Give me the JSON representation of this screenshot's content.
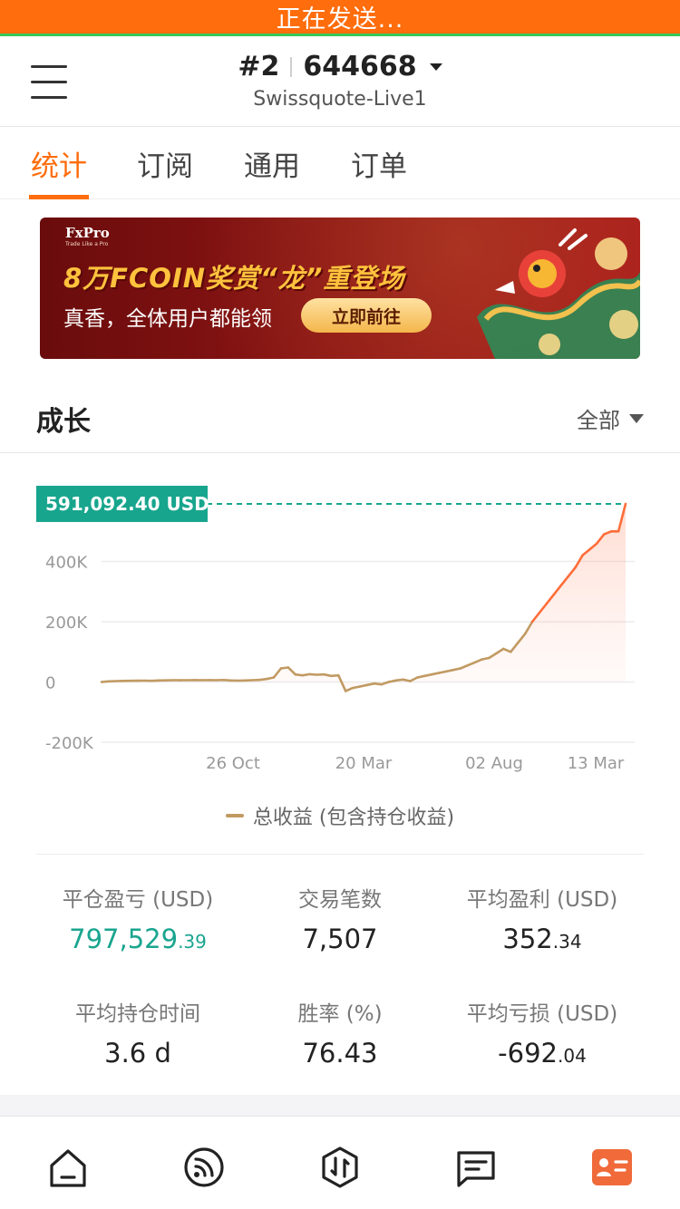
{
  "status": {
    "text": "正在发送..."
  },
  "header": {
    "account_index": "#2",
    "account_number": "644668",
    "server": "Swissquote-Live1"
  },
  "tabs": [
    {
      "label": "统计",
      "active": true
    },
    {
      "label": "订阅",
      "active": false
    },
    {
      "label": "通用",
      "active": false
    },
    {
      "label": "订单",
      "active": false
    }
  ],
  "banner": {
    "brand": "FxPro",
    "tagline": "Trade Like a Pro",
    "headline": "8万FCOIN奖赏“龙”重登场",
    "subtitle": "真香，全体用户都能领",
    "cta": "立即前往"
  },
  "growth": {
    "title": "成长",
    "filter": "全部"
  },
  "chart_data": {
    "type": "area",
    "current_value_label": "591,092.40 USD",
    "current_value": 591092.4,
    "y_ticks": [
      "400K",
      "200K",
      "0",
      "-200K"
    ],
    "x_ticks": [
      "26 Oct",
      "20 Mar",
      "02 Aug",
      "13 Mar"
    ],
    "ylim": [
      -200000,
      600000
    ],
    "grid": true,
    "legend": "总收益 (包含持仓收益)",
    "series": [
      {
        "name": "总收益 (包含持仓收益)",
        "values": [
          0,
          2000,
          3000,
          3500,
          4000,
          4200,
          4500,
          4000,
          5000,
          5500,
          6000,
          5800,
          6000,
          6200,
          6100,
          6300,
          6000,
          6500,
          5000,
          4500,
          5000,
          6000,
          7000,
          10000,
          15000,
          45000,
          48000,
          25000,
          22000,
          26000,
          24000,
          25000,
          20000,
          22000,
          -30000,
          -20000,
          -15000,
          -10000,
          -5000,
          -8000,
          0,
          5000,
          8000,
          3000,
          15000,
          20000,
          25000,
          30000,
          35000,
          40000,
          45000,
          55000,
          65000,
          75000,
          80000,
          95000,
          110000,
          100000,
          130000,
          160000,
          200000,
          230000,
          260000,
          290000,
          320000,
          350000,
          380000,
          420000,
          440000,
          460000,
          490000,
          500000,
          500000,
          591092
        ]
      }
    ],
    "color_positive": "#c19a62",
    "color_recent": "#ff6d3a",
    "marker_color": "#17a58d"
  },
  "stats": [
    {
      "label": "平仓盈亏 (USD)",
      "int": "797,529",
      "dec": ".39",
      "highlight": true
    },
    {
      "label": "交易笔数",
      "int": "7,507",
      "dec": "",
      "highlight": false
    },
    {
      "label": "平均盈利 (USD)",
      "int": "352",
      "dec": ".34",
      "highlight": false
    },
    {
      "label": "平均持仓时间",
      "int": "3.6 d",
      "dec": "",
      "highlight": false
    },
    {
      "label": "胜率 (%)",
      "int": "76.43",
      "dec": "",
      "highlight": false
    },
    {
      "label": "平均亏损 (USD)",
      "int": "-692",
      "dec": ".04",
      "highlight": false
    }
  ],
  "bottom_nav": [
    {
      "icon": "home-icon"
    },
    {
      "icon": "signal-icon"
    },
    {
      "icon": "trade-icon"
    },
    {
      "icon": "history-icon"
    },
    {
      "icon": "profile-icon",
      "active": true
    }
  ]
}
